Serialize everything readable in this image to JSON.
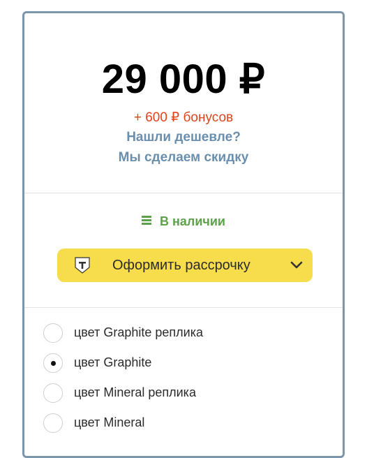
{
  "price": {
    "amount": "29 000 ₽",
    "bonus": "+ 600 ₽ бонусов",
    "cheaper_link": "Нашли дешевле?",
    "cheaper_sub": "Мы сделаем скидку"
  },
  "stock": {
    "status": "В наличии"
  },
  "installment": {
    "label": "Оформить рассрочку"
  },
  "options": [
    {
      "label": "цвет Graphite реплика",
      "selected": false
    },
    {
      "label": "цвет Graphite",
      "selected": true
    },
    {
      "label": "цвет Mineral реплика",
      "selected": false
    },
    {
      "label": "цвет Mineral",
      "selected": false
    }
  ],
  "colors": {
    "border": "#7c96ab",
    "bonus": "#e0441c",
    "link": "#6a8fae",
    "in_stock": "#5da24a",
    "installment_bg": "#f7dc4b"
  }
}
